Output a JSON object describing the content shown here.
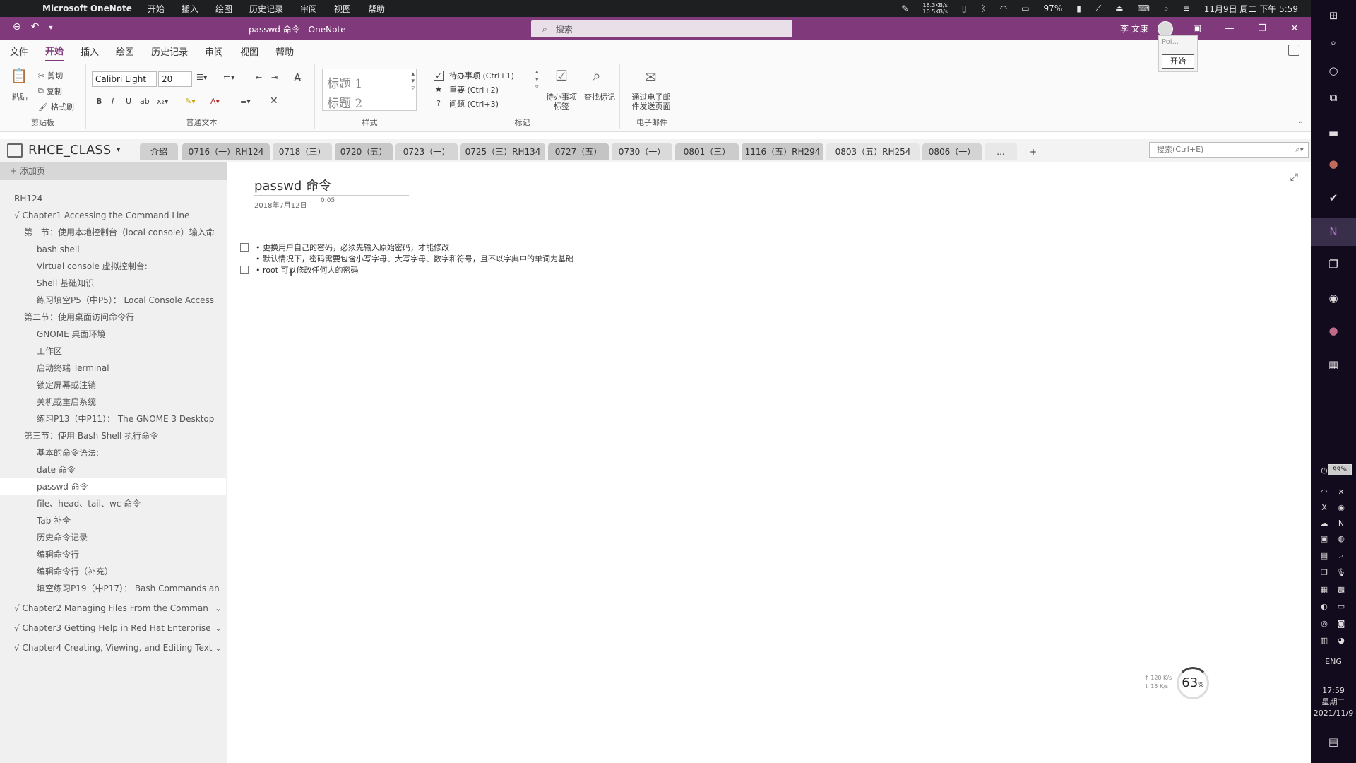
{
  "macbar": {
    "app": "Microsoft OneNote",
    "menus": [
      "开始",
      "插入",
      "绘图",
      "历史记录",
      "审阅",
      "视图",
      "帮助"
    ],
    "net_up": "16.3KB/s",
    "net_down": "10.5KB/s",
    "battery": "97%",
    "datetime": "11月9日 周二 下午 5:59"
  },
  "titlebar": {
    "title": "passwd 命令 - OneNote",
    "search_placeholder": "搜索",
    "user": "李 文康"
  },
  "tooltip": {
    "text": "Poi...",
    "button": "开始"
  },
  "ribbon_tabs": [
    "文件",
    "开始",
    "插入",
    "绘图",
    "历史记录",
    "审阅",
    "视图",
    "帮助"
  ],
  "ribbon_active": "开始",
  "clipboard": {
    "paste": "粘贴",
    "cut": "剪切",
    "copy": "复制",
    "format_painter": "格式刷",
    "label": "剪贴板"
  },
  "basic_text": {
    "font": "Calibri Light",
    "size": "20",
    "label": "普通文本"
  },
  "styles": {
    "heading1": "标题 1",
    "heading2": "标题 2",
    "label": "样式"
  },
  "tags": {
    "items": [
      {
        "label": "待办事项 (Ctrl+1)",
        "icon": "checkbox-icon"
      },
      {
        "label": "重要 (Ctrl+2)",
        "icon": "star-icon"
      },
      {
        "label": "问题 (Ctrl+3)",
        "icon": "question-icon"
      }
    ],
    "todo_tag": "待办事项\n标签",
    "find_tags": "查找标记",
    "label": "标记"
  },
  "email": {
    "send": "通过电子邮\n件发送页面",
    "label": "电子邮件"
  },
  "notebook": {
    "name": "RHCE_CLASS",
    "search_placeholder": "搜索(Ctrl+E)"
  },
  "section_tabs": [
    {
      "label": "介绍",
      "color": "#d0d0d0"
    },
    {
      "label": "0716（一）RH124",
      "color": "#c7c7c7"
    },
    {
      "label": "0718（三）",
      "color": "#d9d9d9"
    },
    {
      "label": "0720（五）",
      "color": "#c8c8c8"
    },
    {
      "label": "0723（一）",
      "color": "#d5d5d5"
    },
    {
      "label": "0725（三）RH134",
      "color": "#cfcfcf"
    },
    {
      "label": "0727（五）",
      "color": "#c4c4c4"
    },
    {
      "label": "0730（一）",
      "color": "#dadada"
    },
    {
      "label": "0801（三）",
      "color": "#cccccc"
    },
    {
      "label": "1116（五）RH294",
      "color": "#c9c9c9"
    },
    {
      "label": "0803（五）RH254",
      "color": "#e6e6e6"
    },
    {
      "label": "0806（一）",
      "color": "#d4d4d4"
    },
    {
      "label": "...",
      "color": "#e8e8e8"
    },
    {
      "label": "+",
      "color": "#f3f3f3"
    }
  ],
  "sidebar": {
    "add_page": "+ 添加页",
    "pages": [
      {
        "label": "RH124",
        "level": 0
      },
      {
        "label": "√ Chapter1 Accessing the Command Line",
        "level": 0
      },
      {
        "label": "第一节：使用本地控制台（local console）输入命",
        "level": 1
      },
      {
        "label": "bash shell",
        "level": 2
      },
      {
        "label": "Virtual console 虚拟控制台:",
        "level": 2
      },
      {
        "label": "Shell 基础知识",
        "level": 2
      },
      {
        "label": "练习填空P5（中P5）：  Local Console Access",
        "level": 2
      },
      {
        "label": "第二节：使用桌面访问命令行",
        "level": 1
      },
      {
        "label": "GNOME 桌面环境",
        "level": 2
      },
      {
        "label": "工作区",
        "level": 2
      },
      {
        "label": "启动终端 Terminal",
        "level": 2
      },
      {
        "label": "锁定屏幕或注销",
        "level": 2
      },
      {
        "label": "关机或重启系统",
        "level": 2
      },
      {
        "label": "练习P13（中P11）：  The GNOME 3 Desktop",
        "level": 2
      },
      {
        "label": "第三节：使用 Bash Shell 执行命令",
        "level": 1
      },
      {
        "label": "基本的命令语法:",
        "level": 2
      },
      {
        "label": "date 命令",
        "level": 2
      },
      {
        "label": "passwd 命令",
        "level": 2,
        "selected": true
      },
      {
        "label": "file、head、tail、wc 命令",
        "level": 2
      },
      {
        "label": "Tab 补全",
        "level": 2
      },
      {
        "label": "历史命令记录",
        "level": 2
      },
      {
        "label": "编辑命令行",
        "level": 2
      },
      {
        "label": "编辑命令行（补充）",
        "level": 2
      },
      {
        "label": "填空练习P19（中P17）：  Bash Commands an",
        "level": 2
      }
    ],
    "chapters": [
      "√ Chapter2 Managing Files From the Comman",
      "√ Chapter3 Getting Help in Red Hat Enterprise",
      "√ Chapter4 Creating, Viewing, and Editing Text"
    ]
  },
  "page": {
    "title": "passwd 命令",
    "date": "2018年7月12日",
    "time": "0:05",
    "notes": [
      {
        "text": "• 更换用户自己的密码，必须先输入原始密码，才能修改",
        "checkbox": true
      },
      {
        "text": "• 默认情况下，密码需要包含小写字母、大写字母、数字和符号，且不以字典中的单词为基础",
        "checkbox": false
      },
      {
        "text": "• root 可以修改任何人的密码",
        "checkbox": true
      }
    ]
  },
  "net_widget": {
    "up": "↑ 120 K/s",
    "down": "↓ 15 K/s",
    "percent": "63",
    "unit": "%"
  },
  "taskbar": {
    "lang": "ENG",
    "time": "17:59",
    "day": "星期二",
    "date": "2021/11/9",
    "battery": "99%"
  }
}
